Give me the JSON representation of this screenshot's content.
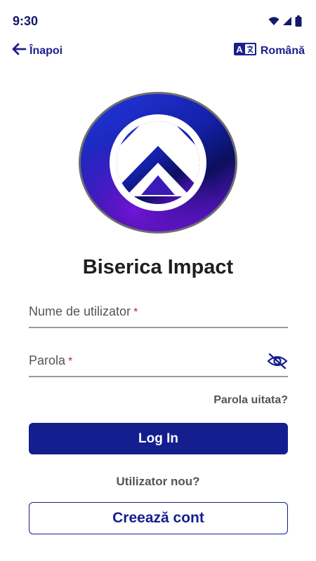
{
  "status_bar": {
    "time": "9:30",
    "icons": [
      "wifi-icon",
      "signal-icon",
      "battery-icon"
    ]
  },
  "header": {
    "back_label": "Înapoi",
    "back_icon": "arrow-left-icon",
    "language_label": "Română",
    "language_icon": "translate-icon"
  },
  "logo": {
    "icon": "church-logo-icon",
    "colors": {
      "blue": "#1a2fd1",
      "purple": "#6a12d6",
      "navy": "#0b0f5c",
      "ring": "#6e6e6e"
    }
  },
  "app": {
    "title": "Biserica Impact"
  },
  "form": {
    "username_label": "Nume de utilizator",
    "password_label": "Parola",
    "required_mark": "*",
    "toggle_icon": "eye-off-icon",
    "forgot_label": "Parola uitata?",
    "login_label": "Log In",
    "new_user_label": "Utilizator nou?",
    "create_label": "Creează cont"
  },
  "theme": {
    "primary": "#141e8f",
    "accent_text": "#1a1f8f",
    "required": "#c62828",
    "muted": "#555555"
  }
}
